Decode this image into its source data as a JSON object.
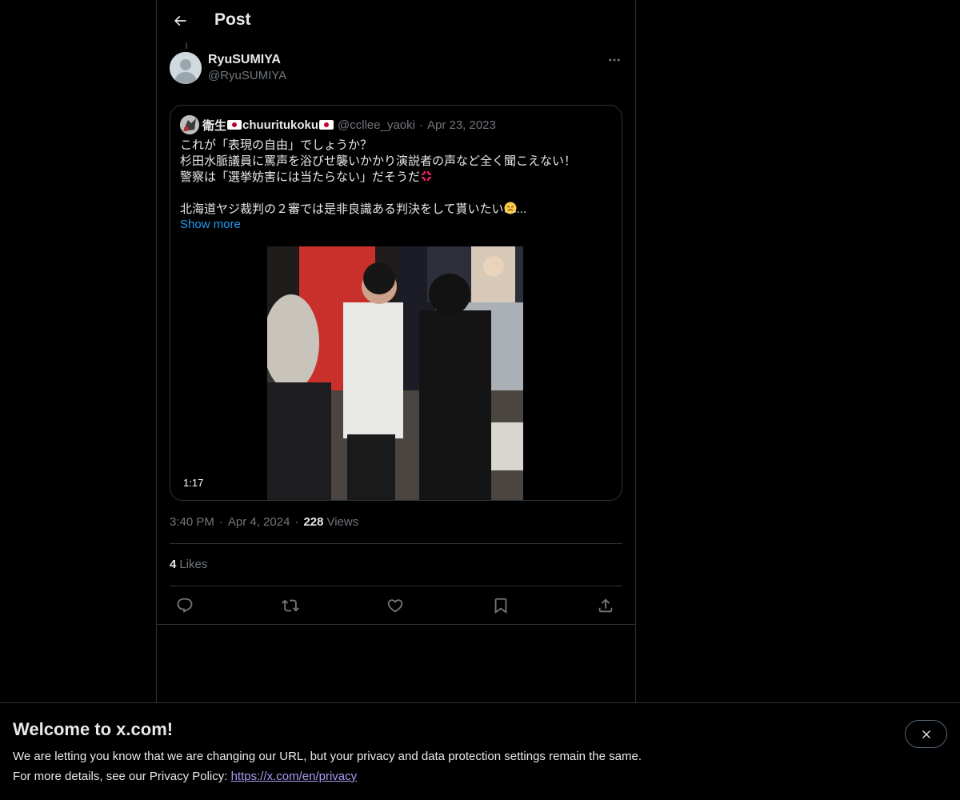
{
  "header": {
    "title": "Post"
  },
  "post": {
    "author_name": "RyuSUMIYA",
    "author_handle": "@RyuSUMIYA",
    "time": "3:40 PM",
    "date": "Apr 4, 2024",
    "views_count": "228",
    "views_label": "Views",
    "likes_count": "4",
    "likes_label": "Likes"
  },
  "quote": {
    "name_part1": "衛生",
    "name_part2": "chuuritukoku",
    "handle": "@ccllee_yaoki",
    "date": "Apr 23, 2023",
    "line1": "これが「表現の自由」でしょうか？",
    "line2": "杉田水脈議員に罵声を浴びせ襲いかかり演説者の声など全く聞こえない！",
    "line3": "警察は「選挙妨害には当たらない」だそうだ",
    "line4": "北海道ヤジ裁判の２審では是非良識ある判決をして貰いたい",
    "ellipsis": "...",
    "show_more": "Show more",
    "video_duration": "1:17"
  },
  "banner": {
    "title": "Welcome to x.com!",
    "line1": "We are letting you know that we are changing our URL, but your privacy and data protection settings remain the same.",
    "line2_prefix": "For more details, see our Privacy Policy: ",
    "link": "https://x.com/en/privacy"
  },
  "icons": {
    "back": "back-arrow-icon",
    "more": "more-dots-icon",
    "reply": "reply-icon",
    "repost": "repost-icon",
    "like": "heart-icon",
    "bookmark": "bookmark-icon",
    "share": "share-icon",
    "close": "close-icon"
  },
  "colors": {
    "background": "#000000",
    "text": "#e7e9ea",
    "secondary": "#71767b",
    "accent": "#1d9bf0",
    "border": "#2f3336",
    "link": "#a99bf0"
  }
}
